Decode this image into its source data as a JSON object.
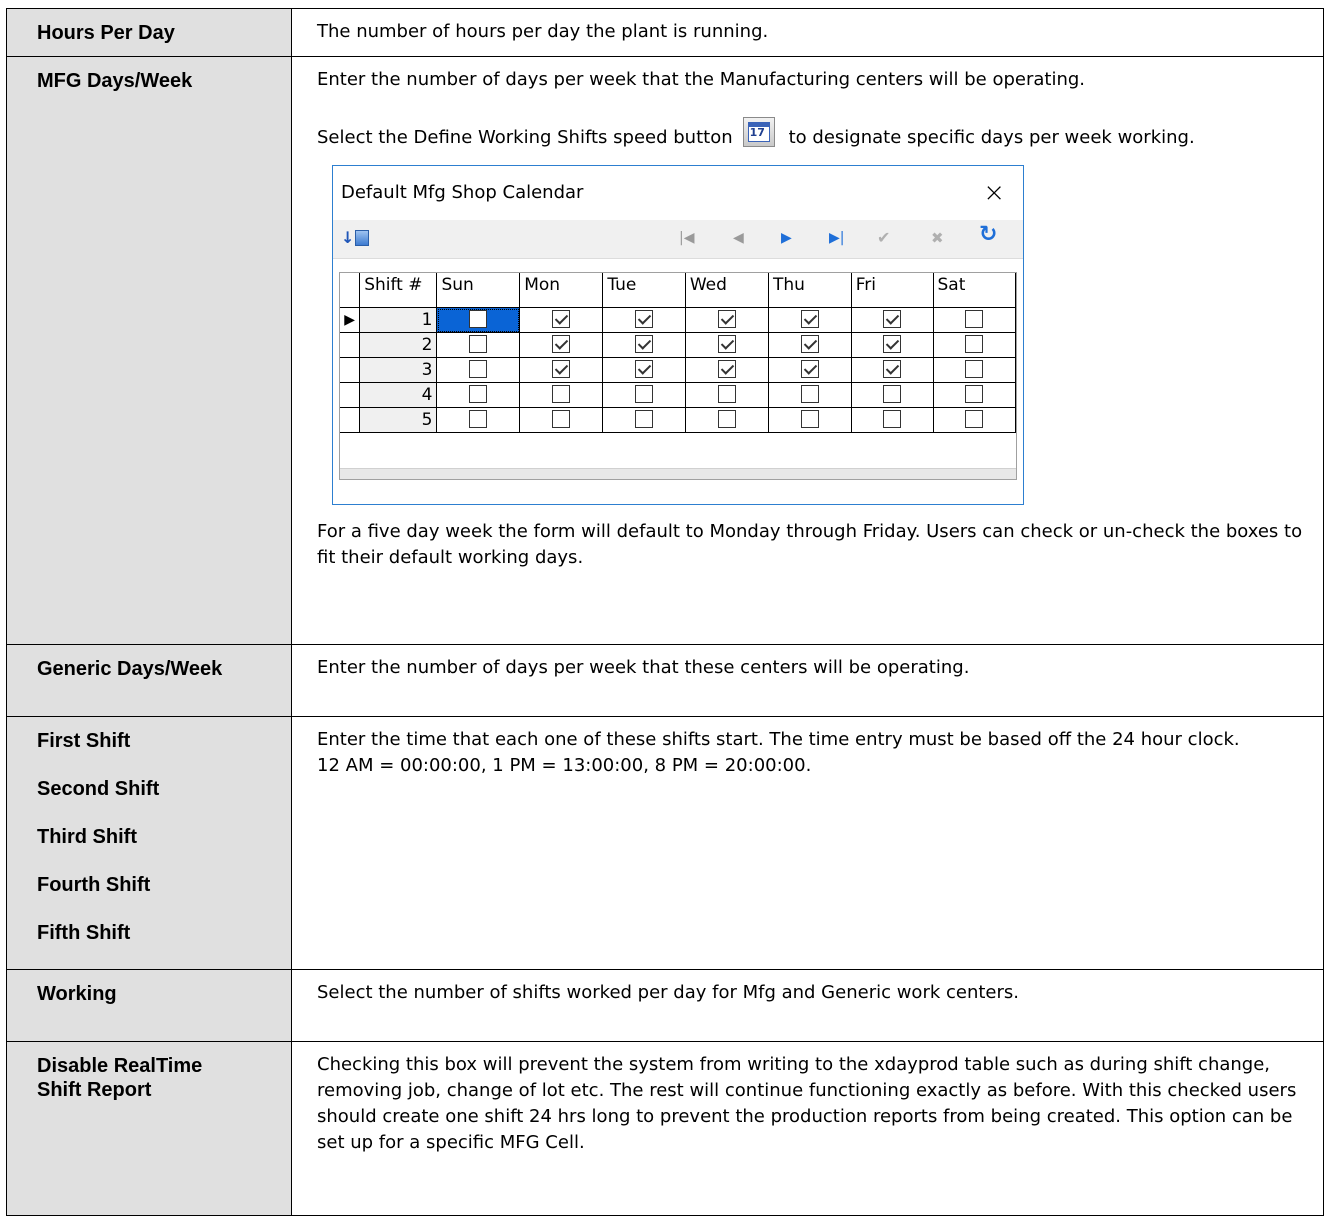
{
  "rows": [
    {
      "label": "Hours Per Day",
      "desc": "The number of hours per day the plant is running."
    },
    {
      "label": "MFG Days/Week",
      "desc1": "Enter the number of days per week that the Manufacturing centers will be operating.",
      "desc2a": "Select the Define Working Shifts speed button",
      "desc2b": "to designate specific days per week working.",
      "desc3": "For a five day week the form will default to Monday through Friday. Users can check or un-check the boxes to fit their default working days."
    },
    {
      "label": "Generic Days/Week",
      "desc": "Enter the number of days per week that these centers will be operating."
    },
    {
      "labels": [
        "First Shift",
        "Second Shift",
        "Third Shift",
        "Fourth Shift",
        "Fifth Shift"
      ],
      "desc1": "Enter the time that each one of these shifts start. The time entry must be based off the 24 hour clock.",
      "desc2": "12 AM = 00:00:00, 1 PM = 13:00:00, 8 PM = 20:00:00."
    },
    {
      "label": "Working",
      "desc": "Select the number of shifts worked per day for Mfg and Generic work centers."
    },
    {
      "label1": "Disable RealTime",
      "label2": "Shift Report",
      "desc": "Checking this box will prevent the system from writing to the xdayprod table such as during shift change, removing job, change of lot etc. The rest will continue functioning exactly as before. With this checked users should create one shift 24 hrs long to prevent the production reports from being created. This option can be set up for a specific MFG Cell."
    }
  ],
  "speed_button_icon": "calendar-icon",
  "speed_button_glyph": "17",
  "dialog": {
    "title": "Default Mfg Shop Calendar",
    "close": "×",
    "columns": [
      "Shift #",
      "Sun",
      "Mon",
      "Tue",
      "Wed",
      "Thu",
      "Fri",
      "Sat"
    ],
    "current_row_marker": "▶",
    "shifts": [
      {
        "num": "1",
        "days": [
          false,
          true,
          true,
          true,
          true,
          true,
          false
        ]
      },
      {
        "num": "2",
        "days": [
          false,
          true,
          true,
          true,
          true,
          true,
          false
        ]
      },
      {
        "num": "3",
        "days": [
          false,
          true,
          true,
          true,
          true,
          true,
          false
        ]
      },
      {
        "num": "4",
        "days": [
          false,
          false,
          false,
          false,
          false,
          false,
          false
        ]
      },
      {
        "num": "5",
        "days": [
          false,
          false,
          false,
          false,
          false,
          false,
          false
        ]
      }
    ],
    "toolbar": {
      "sort": "↓",
      "first": "|◀",
      "prior": "◀",
      "next": "▶",
      "last": "▶|",
      "post": "✔",
      "cancel": "✖",
      "refresh": "↻"
    }
  }
}
